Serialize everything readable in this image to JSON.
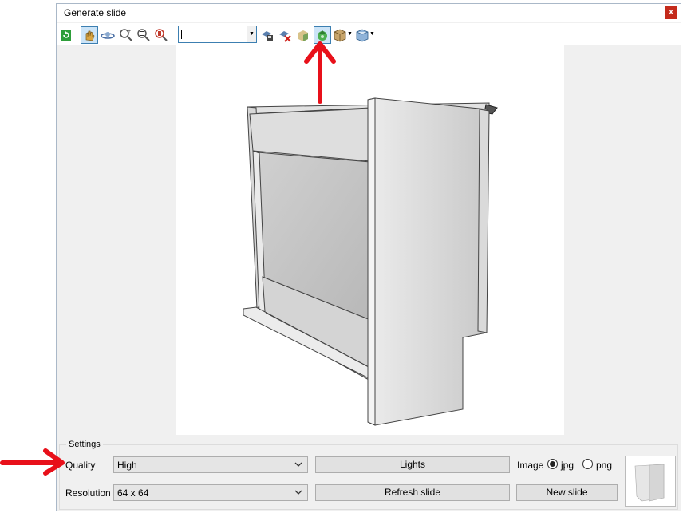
{
  "window": {
    "title": "Generate slide",
    "close_label": "x"
  },
  "toolbar": {
    "view_combo_value": "",
    "icons": [
      "refresh-icon",
      "pan-hand-icon",
      "orbit-icon",
      "zoom-in-icon",
      "zoom-window-icon",
      "zoom-extents-icon",
      "camera-save-icon",
      "camera-delete-icon",
      "shade-icon",
      "render-icon",
      "box-view-icon",
      "iso-view-icon"
    ]
  },
  "settings": {
    "legend": "Settings",
    "quality_label": "Quality",
    "quality_value": "High",
    "resolution_label": "Resolution",
    "resolution_value": "64 x 64",
    "lights_button": "Lights",
    "refresh_button": "Refresh slide",
    "new_slide_button": "New slide",
    "image_label": "Image",
    "image_options": [
      {
        "label": "jpg",
        "selected": true
      },
      {
        "label": "png",
        "selected": false
      }
    ]
  },
  "colors": {
    "annotation_arrow": "#e8101a",
    "accent": "#3c7fb1"
  }
}
